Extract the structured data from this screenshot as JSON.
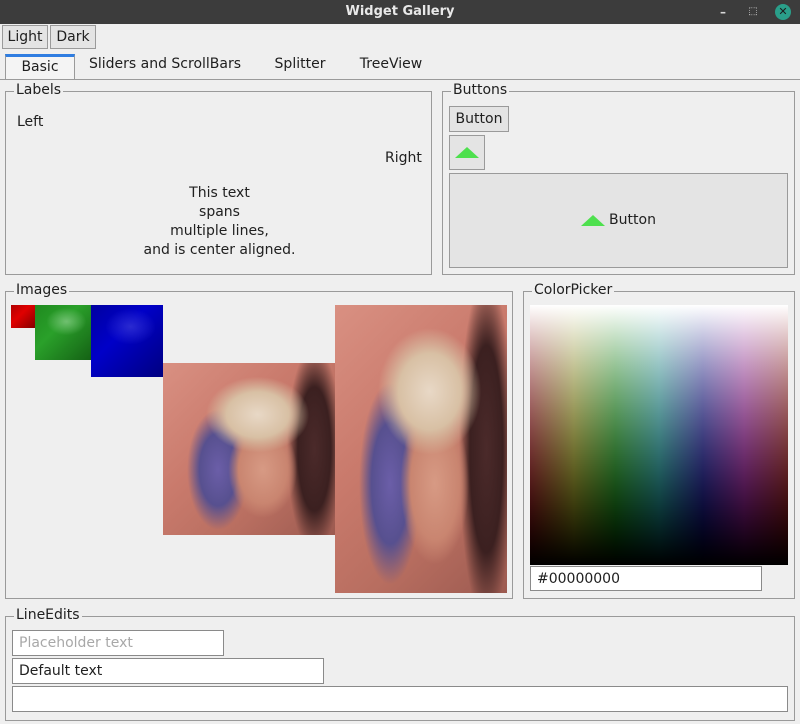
{
  "window": {
    "title": "Widget Gallery"
  },
  "theme_buttons": {
    "light": "Light",
    "dark": "Dark"
  },
  "tabs": [
    "Basic",
    "Sliders and ScrollBars",
    "Splitter",
    "TreeView"
  ],
  "labels_group": {
    "title": "Labels",
    "left": "Left",
    "right": "Right",
    "multiline": [
      "This text",
      "spans",
      "multiple lines,",
      "and is center aligned."
    ]
  },
  "buttons_group": {
    "title": "Buttons",
    "text_button": "Button",
    "icon_text_button": "Button",
    "icon": "arrow-up-icon"
  },
  "images_group": {
    "title": "Images"
  },
  "colorpicker_group": {
    "title": "ColorPicker",
    "hex_value": "#00000000"
  },
  "lineedits_group": {
    "title": "LineEdits",
    "placeholder": "Placeholder text",
    "default_value": "Default text",
    "empty_value": ""
  },
  "colors": {
    "accent": "#2f7de1",
    "icon_green": "#4ee04e",
    "close_button": "#2a9f8a"
  }
}
